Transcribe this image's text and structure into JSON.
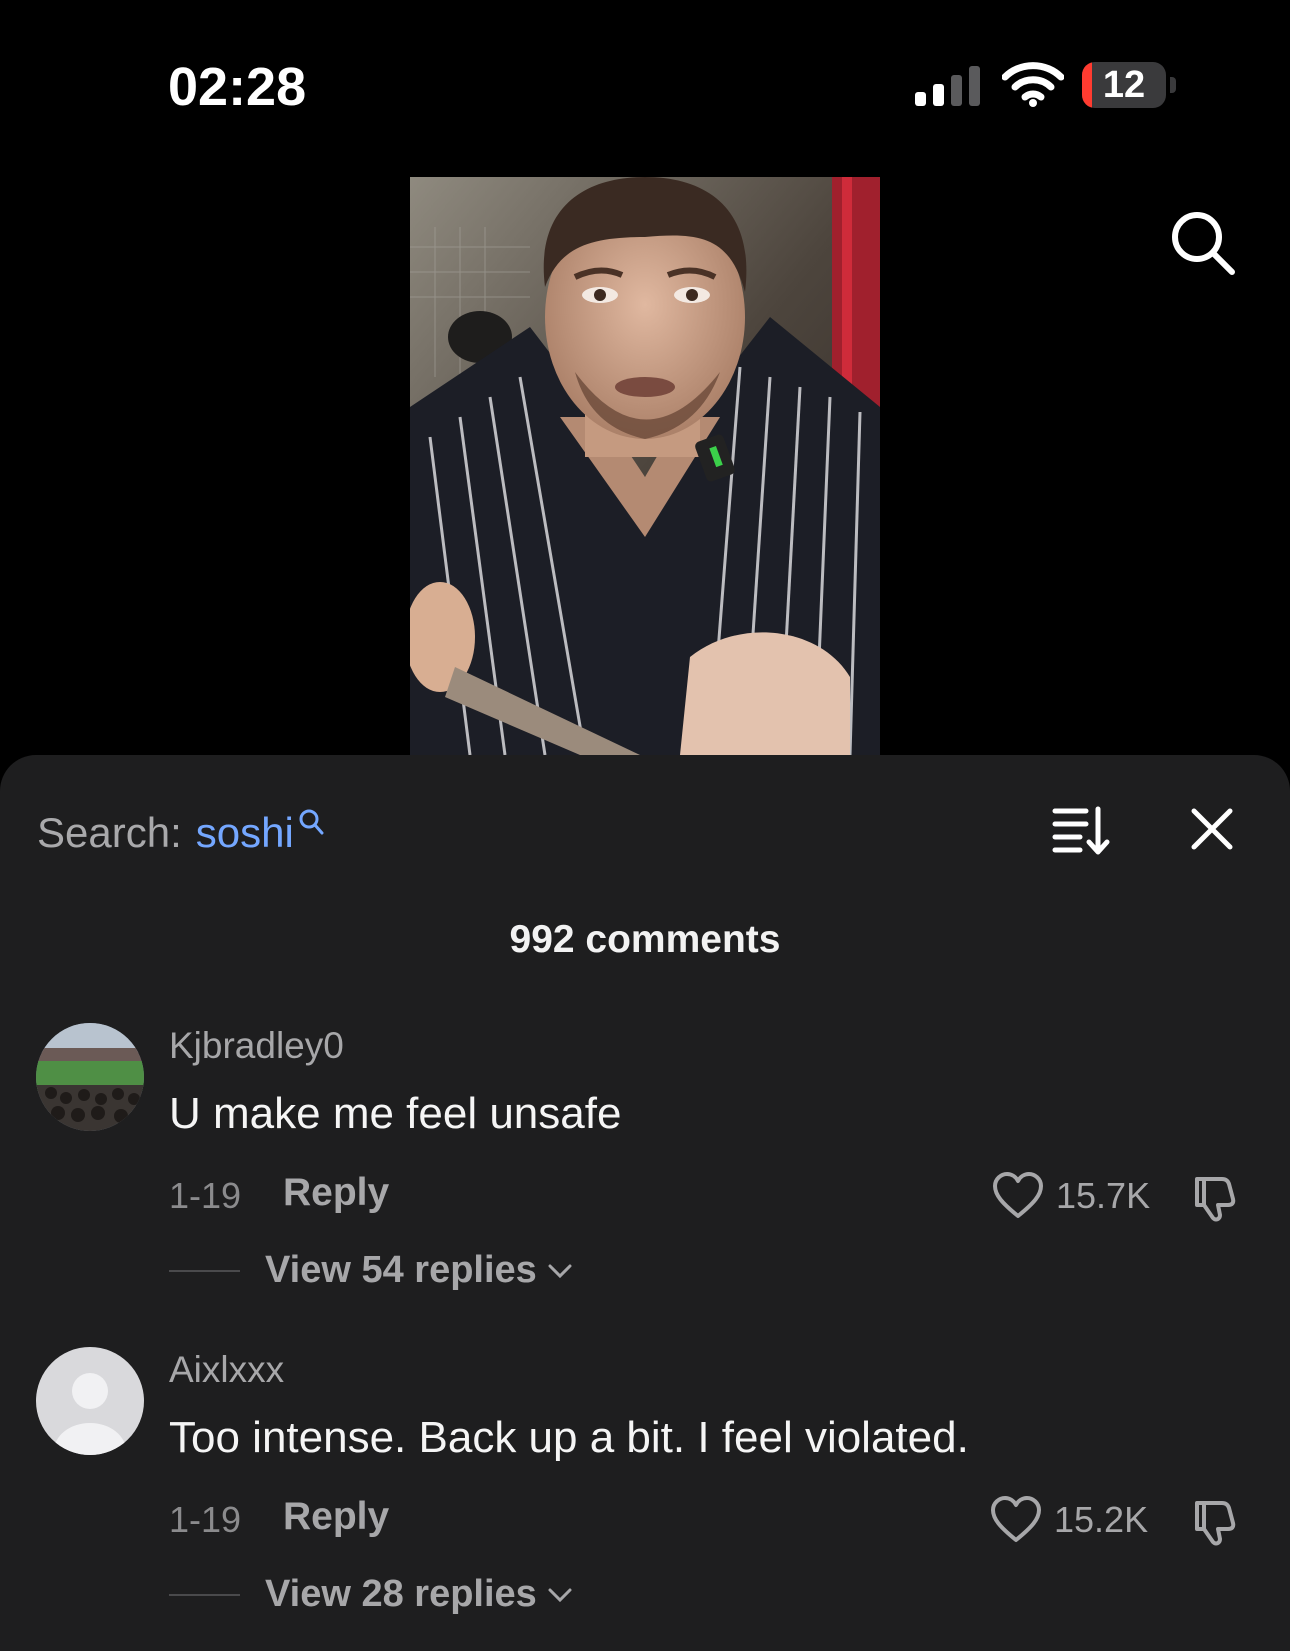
{
  "status": {
    "time": "02:28",
    "battery": "12",
    "battery_fraction": 0.12
  },
  "video": {
    "icon": "video-frame"
  },
  "top_search": {
    "icon": "search-icon"
  },
  "sheet": {
    "search_label": "Search:",
    "search_term": "soshi",
    "count": "992 comments",
    "icons": {
      "sort": "sort-icon",
      "close": "close-icon"
    }
  },
  "comments": [
    {
      "username": "Kjbradley0",
      "text": "U make me feel unsafe",
      "date": "1-19",
      "reply_label": "Reply",
      "likes": "15.7K",
      "view_replies": "View 54 replies"
    },
    {
      "username": "Aixlxxx",
      "text": "Too intense. Back up a bit. I feel violated.",
      "date": "1-19",
      "reply_label": "Reply",
      "likes": "15.2K",
      "view_replies": "View 28 replies"
    }
  ],
  "colors": {
    "accent": "#74a7ff",
    "sheet": "#1e1e1f",
    "battery_low": "#ff3b30"
  }
}
